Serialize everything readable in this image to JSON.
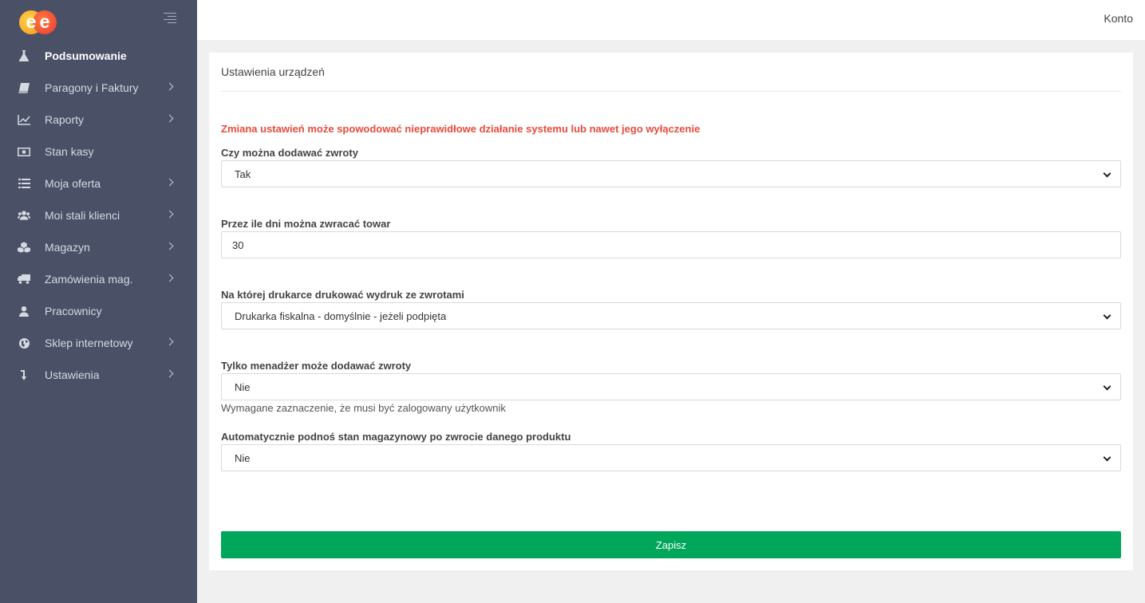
{
  "app": {
    "logo_text": [
      "e",
      "e"
    ],
    "account_label": "Konto"
  },
  "sidebar": {
    "items": [
      {
        "label": "Podsumowanie",
        "icon": "flask-icon",
        "active": true,
        "has_submenu": false
      },
      {
        "label": "Paragony i Faktury",
        "icon": "book-icon",
        "active": false,
        "has_submenu": true
      },
      {
        "label": "Raporty",
        "icon": "line-chart-icon",
        "active": false,
        "has_submenu": true
      },
      {
        "label": "Stan kasy",
        "icon": "money-icon",
        "active": false,
        "has_submenu": false
      },
      {
        "label": "Moja oferta",
        "icon": "list-icon",
        "active": false,
        "has_submenu": true
      },
      {
        "label": "Moi stali klienci",
        "icon": "users-icon",
        "active": false,
        "has_submenu": true
      },
      {
        "label": "Magazyn",
        "icon": "cubes-icon",
        "active": false,
        "has_submenu": true
      },
      {
        "label": "Zamówienia mag.",
        "icon": "truck-icon",
        "active": false,
        "has_submenu": true
      },
      {
        "label": "Pracownicy",
        "icon": "user-icon",
        "active": false,
        "has_submenu": false
      },
      {
        "label": "Sklep internetowy",
        "icon": "globe-icon",
        "active": false,
        "has_submenu": true
      },
      {
        "label": "Ustawienia",
        "icon": "level-down-icon",
        "active": false,
        "has_submenu": true
      }
    ]
  },
  "page": {
    "title": "Ustawienia urządzeń",
    "warning": "Zmiana ustawień może spowodować nieprawidłowe działanie systemu lub nawet jego wyłączenie",
    "fields": {
      "returns_allowed": {
        "label": "Czy można dodawać zwroty",
        "value": "Tak"
      },
      "return_days": {
        "label": "Przez ile dni można zwracać towar",
        "value": "30"
      },
      "return_printer": {
        "label": "Na której drukarce drukować wydruk ze zwrotami",
        "value": "Drukarka fiskalna - domyślnie - jeżeli podpięta"
      },
      "manager_only": {
        "label": "Tylko menadżer może dodawać zwroty",
        "value": "Nie",
        "help": "Wymagane zaznaczenie, że musi być zalogowany użytkownik"
      },
      "auto_restock": {
        "label": "Automatycznie podnoś stan magazynowy po zwrocie danego produktu",
        "value": "Nie"
      }
    },
    "save_label": "Zapisz"
  },
  "colors": {
    "sidebar_bg": "#4a5167",
    "warning": "#e84b3c",
    "save_button": "#00a65a"
  }
}
